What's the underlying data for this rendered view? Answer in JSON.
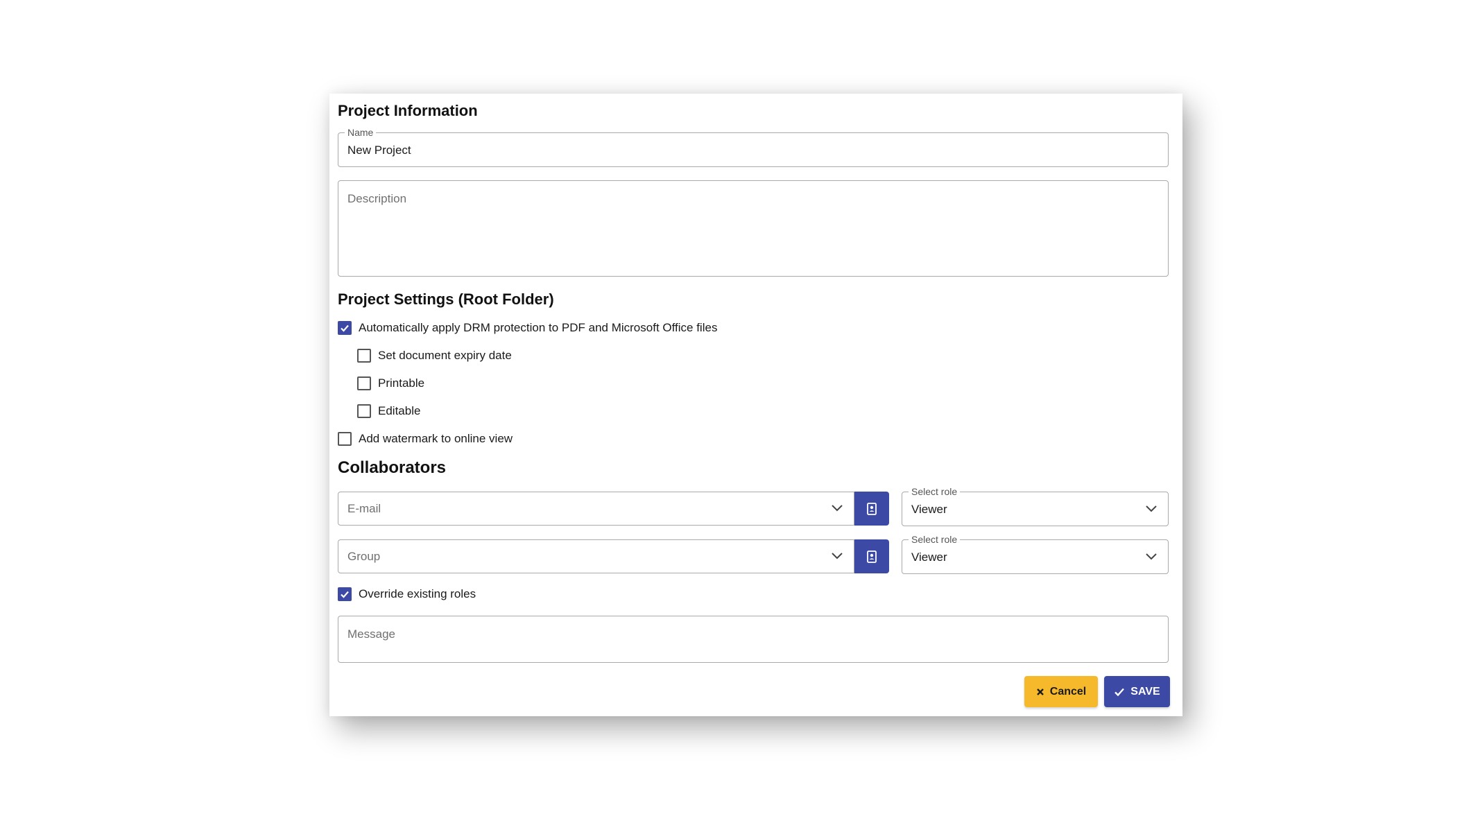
{
  "project_info": {
    "heading": "Project Information",
    "name_label": "Name",
    "name_value": "New Project",
    "description_placeholder": "Description"
  },
  "settings": {
    "heading": "Project Settings (Root Folder)",
    "drm": {
      "label": "Automatically apply DRM protection to PDF and Microsoft Office files",
      "checked": true
    },
    "expiry": {
      "label": "Set document expiry date",
      "checked": false
    },
    "printable": {
      "label": "Printable",
      "checked": false
    },
    "editable": {
      "label": "Editable",
      "checked": false
    },
    "watermark": {
      "label": "Add watermark to online view",
      "checked": false
    }
  },
  "collaborators": {
    "heading": "Collaborators",
    "email_placeholder": "E-mail",
    "group_placeholder": "Group",
    "role_label": "Select role",
    "email_role_value": "Viewer",
    "group_role_value": "Viewer",
    "override": {
      "label": "Override existing roles",
      "checked": true
    },
    "message_placeholder": "Message"
  },
  "actions": {
    "cancel_label": "Cancel",
    "save_label": "SAVE"
  },
  "icons": {
    "checkbox_checked": "check-icon",
    "dropdown": "chevron-down-icon",
    "address_book": "address-book-icon",
    "cancel": "close-icon",
    "save": "check-icon"
  },
  "colors": {
    "primary": "#3c4aa6",
    "warning": "#f6b92b",
    "border": "#a9a9a9"
  }
}
